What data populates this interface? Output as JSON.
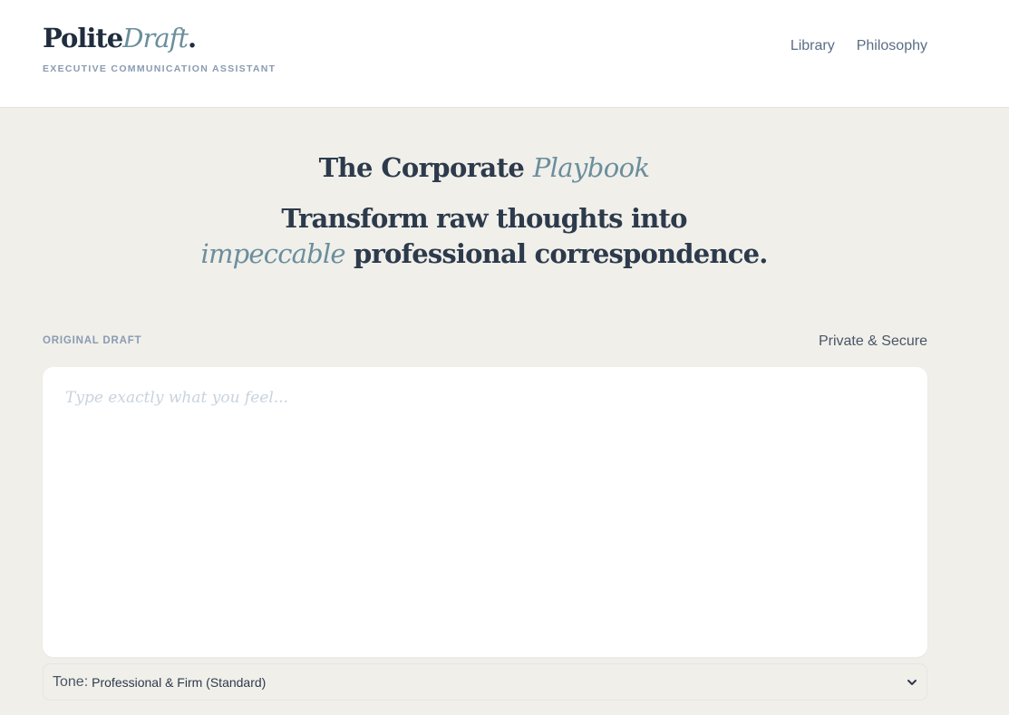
{
  "brand": {
    "name_main": "Polite",
    "name_accent": "Draft",
    "name_dot": ".",
    "tagline": "EXECUTIVE COMMUNICATION ASSISTANT"
  },
  "nav": {
    "items": [
      {
        "label": "Library"
      },
      {
        "label": "Philosophy"
      }
    ]
  },
  "hero": {
    "title_main": "The Corporate ",
    "title_accent": "Playbook",
    "subtitle_line1": "Transform raw thoughts into",
    "subtitle_accent": "impeccable",
    "subtitle_rest": " professional correspondence."
  },
  "draft": {
    "label": "ORIGINAL DRAFT",
    "secure_text": "Private & Secure",
    "placeholder": "Type exactly what you feel...",
    "value": ""
  },
  "tone": {
    "label": "Tone:",
    "selected": "Professional & Firm (Standard)"
  },
  "colors": {
    "background": "#f0efea",
    "accent": "#6b8e9c",
    "heading": "#2c3a4b",
    "muted": "#8a9bb0"
  },
  "icons": {
    "tone_dropdown": "chevron-down-icon"
  }
}
